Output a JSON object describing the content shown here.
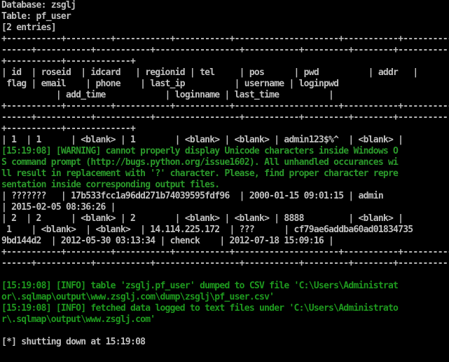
{
  "colors": {
    "background": "#000000",
    "text_default": "#c0c0c0",
    "text_info": "#1e9a1e",
    "text_warning": "#2b9a2b",
    "annotation_arrow": "#e8261f"
  },
  "console": {
    "lines": [
      {
        "text": "Database: zsglj",
        "kind": "output"
      },
      {
        "text": "Table: pf_user",
        "kind": "output"
      },
      {
        "text": "[2 entries]",
        "kind": "output"
      },
      {
        "text": "+-----------+---------+-----------+-----------+---------------------+-----------+-----------+",
        "kind": "output"
      },
      {
        "text": "------+-----------+-----------+-----------------+-----------+---------+--------+----------",
        "kind": "output"
      },
      {
        "text": "+-----------+-------------+",
        "kind": "output"
      },
      {
        "text": "| id  | roseid  | idcard   | regionid | tel     | pos      | pwd          | addr   |",
        "kind": "output"
      },
      {
        "text": " flag | email    | phone    | last_ip          | username | loginpwd",
        "kind": "output"
      },
      {
        "text": "           | add_time            | loginname | last_time          |",
        "kind": "output"
      },
      {
        "text": "+-----------+---------+-----------+-----------+---------------------+-----------+-----------+",
        "kind": "output"
      },
      {
        "text": "------+-----------+-----------+-----------------+-----------+---------+--------+----------",
        "kind": "output"
      },
      {
        "text": "+-----------+-------------+",
        "kind": "output"
      },
      {
        "text": "| 1  | 1      | <blank> | 1        | <blank> | <blank> | admin123$%^  | <blank> |",
        "kind": "output"
      },
      {
        "text": "[15:19:08] [WARNING] cannot properly display Unicode characters inside Windows O",
        "kind": "warning"
      },
      {
        "text": "S command prompt (http://bugs.python.org/issue1602). All unhandled occurances wi",
        "kind": "warning"
      },
      {
        "text": "ll result in replacement with '?' character. Please, find proper character repre",
        "kind": "warning"
      },
      {
        "text": "sentation inside corresponding output files.",
        "kind": "warning"
      },
      {
        "text": "| ???????   | 17b533fcc1a96dd271b74039595fdf96  | 2000-01-15 09:01:15 | admin",
        "kind": "output"
      },
      {
        "text": "| 2015-02-05 08:36:26 |",
        "kind": "output"
      },
      {
        "text": "| 2  | 2      | <blank> | 2        | <blank> | <blank> | 8888         | <blank> |",
        "kind": "output"
      },
      {
        "text": " 1    | <blank>  | <blank>  | 14.114.225.172  | ???      | cf79ae6addba60ad01834735",
        "kind": "output"
      },
      {
        "text": "9bd144d2  | 2012-05-30 03:13:34 | chenck    | 2012-07-18 15:09:16 |",
        "kind": "output"
      },
      {
        "text": "+-----------+---------+-----------+-----------+---------------------+-----------+-----------+",
        "kind": "output"
      },
      {
        "text": "------+-----------+-----------+-----------------+-----------+---------+--------+----------",
        "kind": "output"
      },
      {
        "text": "",
        "kind": "output"
      },
      {
        "text": "[15:19:08] [INFO] table 'zsglj.pf_user' dumped to CSV file 'C:\\Users\\Administrat",
        "kind": "info"
      },
      {
        "text": "or\\.sqlmap\\output\\www.zsglj.com\\dump\\zsglj\\pf_user.csv'",
        "kind": "info"
      },
      {
        "text": "[15:19:08] [INFO] fetched data logged to text files under 'C:\\Users\\Administrato",
        "kind": "info"
      },
      {
        "text": "r\\.sqlmap\\output\\www.zsglj.com'",
        "kind": "info"
      },
      {
        "text": "",
        "kind": "output"
      },
      {
        "text": "[*] shutting down at 15:19:08",
        "kind": "output"
      }
    ]
  }
}
